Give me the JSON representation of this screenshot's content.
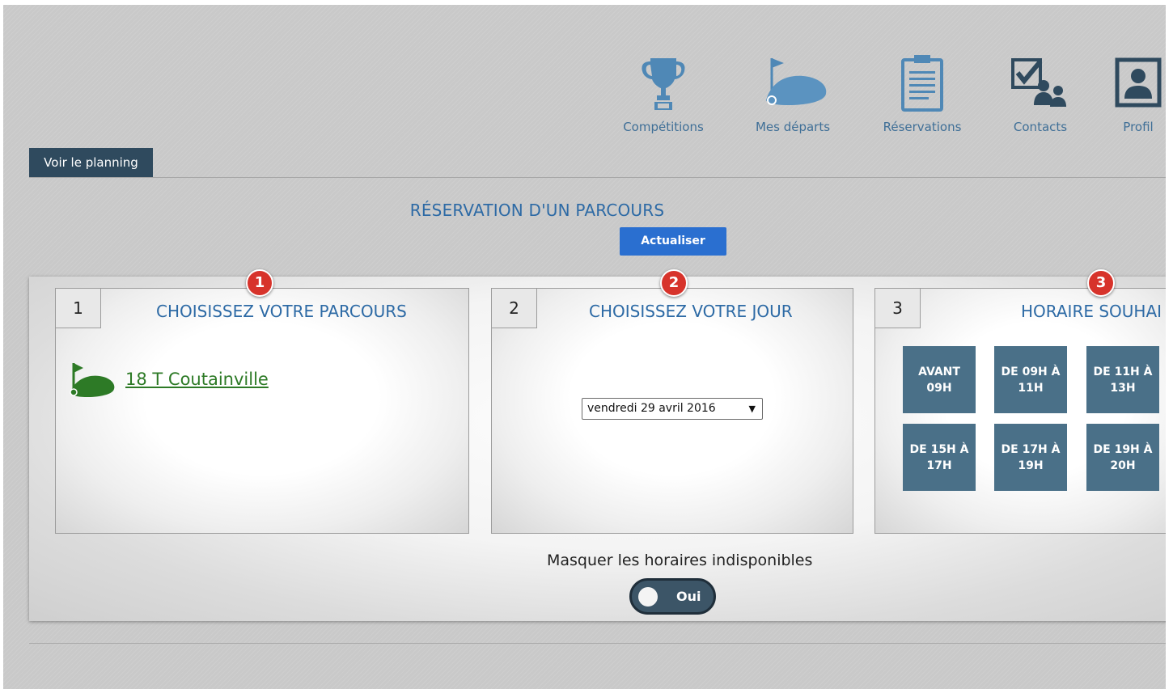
{
  "nav": {
    "items": [
      {
        "label": "Compétitions",
        "icon": "trophy-icon"
      },
      {
        "label": "Mes départs",
        "icon": "golf-flag-icon"
      },
      {
        "label": "Réservations",
        "icon": "clipboard-icon"
      },
      {
        "label": "Contacts",
        "icon": "contacts-icon"
      },
      {
        "label": "Profil",
        "icon": "profile-icon"
      }
    ],
    "color": "#3f6f97"
  },
  "planning_button": "Voir le planning",
  "title": "RÉSERVATION D'UN PARCOURS",
  "refresh_button": "Actualiser",
  "steps": [
    {
      "num": "1",
      "title": "CHOISISSEZ VOTRE PARCOURS",
      "badge": "1"
    },
    {
      "num": "2",
      "title": "CHOISISSEZ VOTRE JOUR",
      "badge": "2"
    },
    {
      "num": "3",
      "title": "HORAIRE SOUHAI",
      "badge": "3"
    }
  ],
  "course": {
    "name": "18 T Coutainville"
  },
  "date_select": {
    "value": "vendredi 29 avril 2016"
  },
  "time_slots": [
    "AVANT 09H",
    "DE 09H À 11H",
    "DE 11H À 13H",
    "DE 15H À 17H",
    "DE 17H À 19H",
    "DE 19H À 20H"
  ],
  "mask_unavailable": {
    "label": "Masquer les horaires indisponibles",
    "toggle_value": "Oui"
  },
  "colors": {
    "accent": "#2d6aa5",
    "button": "#2a6fd0",
    "slot": "#4a7088",
    "badge": "#d7332b",
    "link": "#2d7a26"
  }
}
